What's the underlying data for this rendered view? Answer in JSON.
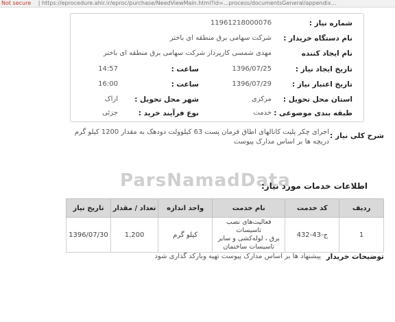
{
  "browser": {
    "security_label": "Not secure",
    "url": "| https://eprocedure.ahir.ir/eproc/purchase/NeedViewMain.html?id=...process/documentsGeneral/appendix..."
  },
  "fields": {
    "need_number": {
      "label": "شماره نیاز :",
      "value": "11961218000076"
    },
    "buyer_org": {
      "label": "نام دستگاه خریدار :",
      "value": "شرکت سهامی برق منطقه ای باختر"
    },
    "creator": {
      "label": "نام ایجاد کننده",
      "value": "مهدی شمسی کارپرداز شرکت سهامی برق منطقه ای باختر"
    },
    "need_date": {
      "label": "تاریخ ایجاد نیاز :",
      "value": "1396/07/25",
      "time_label": "ساعت :",
      "time": "14:57"
    },
    "validity_date": {
      "label": "تاریخ اعتبار نیاز :",
      "value": "1396/07/29",
      "time_label": "ساعت :",
      "time": "16:00"
    },
    "delivery_province": {
      "label": "استان محل تحویل :",
      "value": "مرکزی",
      "city_label": "شهر محل تحویل :",
      "city": "اراک"
    },
    "category": {
      "label": "طبقه بندی موضوعی :",
      "value": "خدمت",
      "process_label": "نوع فرآیند خرید :",
      "process": "جزئی"
    }
  },
  "summary": {
    "label": "شرح کلی نیاز :",
    "line1": "اجرای چکر پلیت کانالهای اطاق فرمان پست 63 کیلوولت دودهک به مقدار 1200 کیلو گرم",
    "line2": "دریچه ها بر اساس مدارک پیوست"
  },
  "watermark": "ParsNamadData",
  "services": {
    "title": "اطلاعات خدمات مورد نیاز:",
    "headers": [
      "ردیف",
      "کد خدمت",
      "نام خدمت",
      "واحد اندازه",
      "تعداد / مقدار",
      "تاریخ نیاز"
    ],
    "rows": [
      {
        "row": "1",
        "code": "ج-43-432",
        "name_line1": "فعالیت‌های نصب تاسیسات",
        "name_line2": "برق ، لوله‌کشی و سایر",
        "name_line3": "تاسیسات ساختمان",
        "unit": "کیلو گرم",
        "qty": "1,200",
        "date": "1396/07/30"
      }
    ]
  },
  "buyer_notes": {
    "label": "توضیحات خریدار",
    "text": "پیشنهاد ها بر اساس مدارک پیوست تهیه وبارکد گذاری شود"
  }
}
